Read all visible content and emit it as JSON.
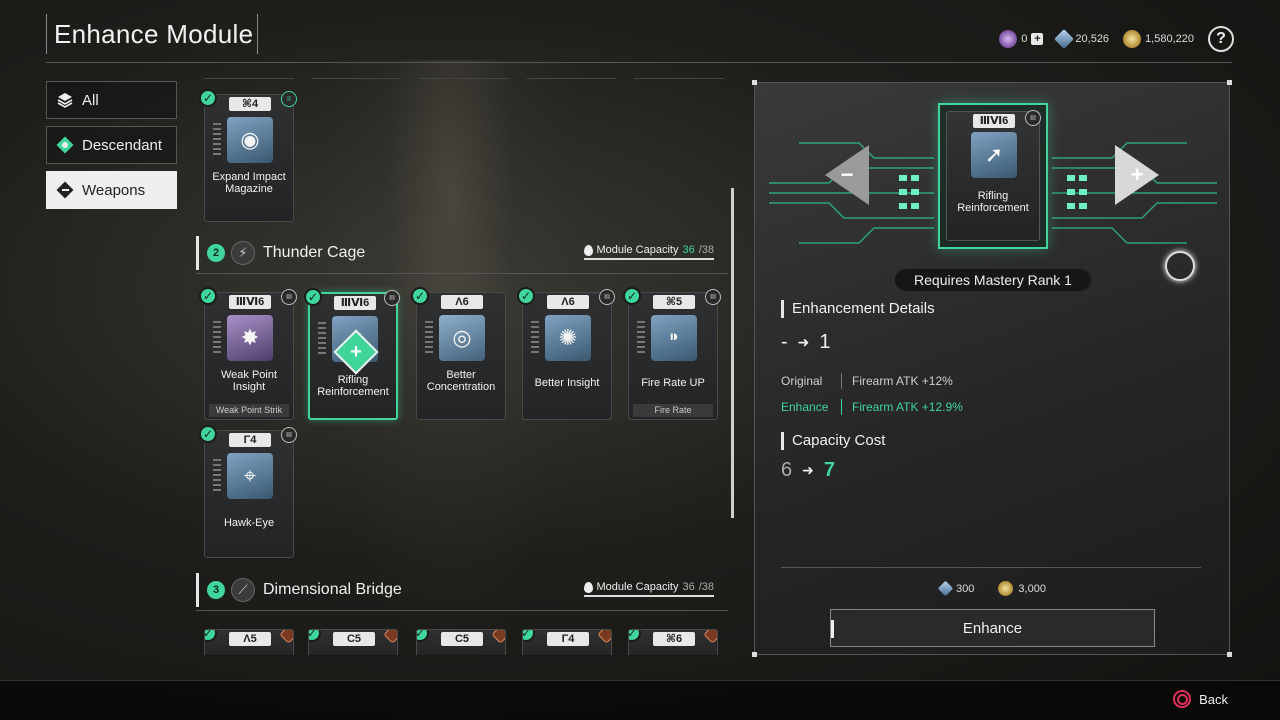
{
  "header": {
    "title": "Enhance Module"
  },
  "currency": [
    {
      "icon": "kuiper-shard-icon",
      "value": "0",
      "has_plus": true
    },
    {
      "icon": "crystal-icon",
      "value": "20,526"
    },
    {
      "icon": "gold-icon",
      "value": "1,580,220"
    }
  ],
  "help_label": "?",
  "filters": [
    {
      "label": "All",
      "active": false
    },
    {
      "label": "Descendant",
      "active": false
    },
    {
      "label": "Weapons",
      "active": true
    }
  ],
  "top_card": {
    "badge": "⌘4",
    "name": "Expand Impact Magazine"
  },
  "sections": [
    {
      "num": "2",
      "name": "Thunder Cage",
      "capacity_label": "Module Capacity",
      "capacity_used": "36",
      "capacity_max": "/38",
      "cards": [
        {
          "badge": "ⅢⅥ6",
          "name": "Weak Point Insight",
          "foot": "Weak Point Strik"
        },
        {
          "badge": "ⅢⅥ6",
          "name": "Rifling Reinforcement",
          "foot": ""
        },
        {
          "badge": "Λ6",
          "name": "Better Concentration",
          "foot": ""
        },
        {
          "badge": "Λ6",
          "name": "Better Insight",
          "foot": ""
        },
        {
          "badge": "⌘5",
          "name": "Fire Rate UP",
          "foot": "Fire Rate"
        },
        {
          "badge": "Γ4",
          "name": "Hawk-Eye",
          "foot": ""
        }
      ]
    },
    {
      "num": "3",
      "name": "Dimensional Bridge",
      "capacity_label": "Module Capacity",
      "capacity_used": "36",
      "capacity_max": "/38",
      "cards": [
        {
          "badge": "Λ5"
        },
        {
          "badge": "Ϲ5"
        },
        {
          "badge": "Ϲ5"
        },
        {
          "badge": "Γ4"
        },
        {
          "badge": "⌘6"
        }
      ]
    }
  ],
  "detail": {
    "card_badge": "ⅢⅥ6",
    "card_name": "Rifling Reinforcement",
    "mastery": "Requires Mastery Rank 1",
    "enh_details_title": "Enhancement Details",
    "level_from": "-",
    "level_to": "1",
    "original_label": "Original",
    "original_value": "Firearm ATK +12%",
    "enhance_label": "Enhance",
    "enhance_value": "Firearm ATK +12.9%",
    "capacity_title": "Capacity Cost",
    "cap_from": "6",
    "cap_to": "7",
    "cost_crystal": "300",
    "cost_gold": "3,000",
    "enhance_button": "Enhance"
  },
  "footer": {
    "back_label": "Back"
  },
  "colors": {
    "accent_green": "#3fd59b",
    "cancel_red": "#e0315a"
  }
}
